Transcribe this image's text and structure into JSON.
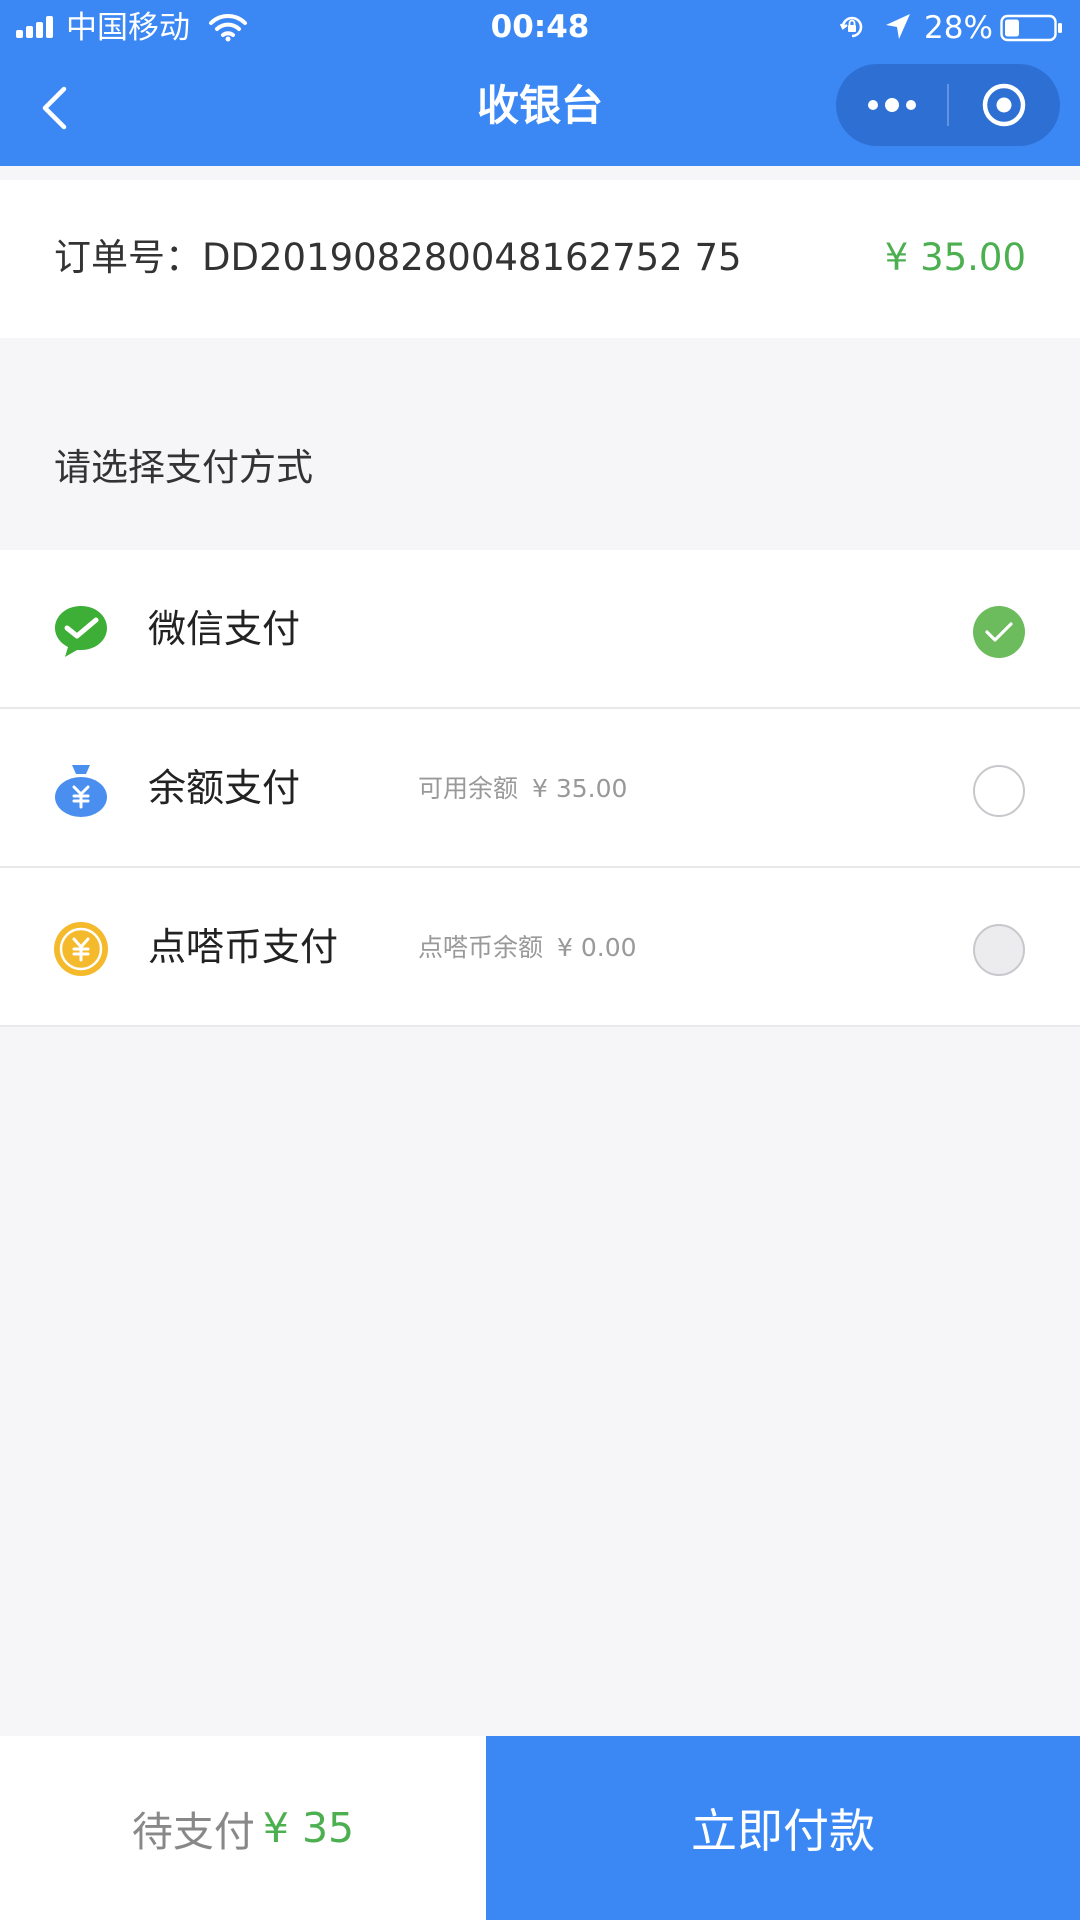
{
  "status_bar": {
    "carrier": "中国移动",
    "time": "00:48",
    "battery": "28%"
  },
  "nav": {
    "title": "收银台",
    "back_icon": "chevron-left-icon",
    "more_icon": "more-dots-icon",
    "close_icon": "target-close-icon"
  },
  "order": {
    "label": "订单号：DD201908280048162752 75",
    "amount": "¥ 35.00"
  },
  "section_title": "请选择支付方式",
  "payment_methods": [
    {
      "name": "微信支付",
      "sub_label": "",
      "sub_value": "",
      "icon": "wechat-pay-icon",
      "state": "checked"
    },
    {
      "name": "余额支付",
      "sub_label": "可用余额",
      "sub_value": "¥ 35.00",
      "icon": "money-bag-icon",
      "state": "unchecked"
    },
    {
      "name": "点嗒币支付",
      "sub_label": "点嗒币余额",
      "sub_value": "¥ 0.00",
      "icon": "coin-icon",
      "state": "disabled"
    }
  ],
  "footer": {
    "pending_label": "待支付",
    "pending_amount": "¥ 35",
    "pay_button": "立即付款"
  },
  "colors": {
    "primary": "#3b88f5",
    "capsule": "#2e6fd4",
    "success": "#4caf50",
    "check": "#6cbb5c",
    "wechat": "#3dae36",
    "coin": "#f5b92c"
  }
}
